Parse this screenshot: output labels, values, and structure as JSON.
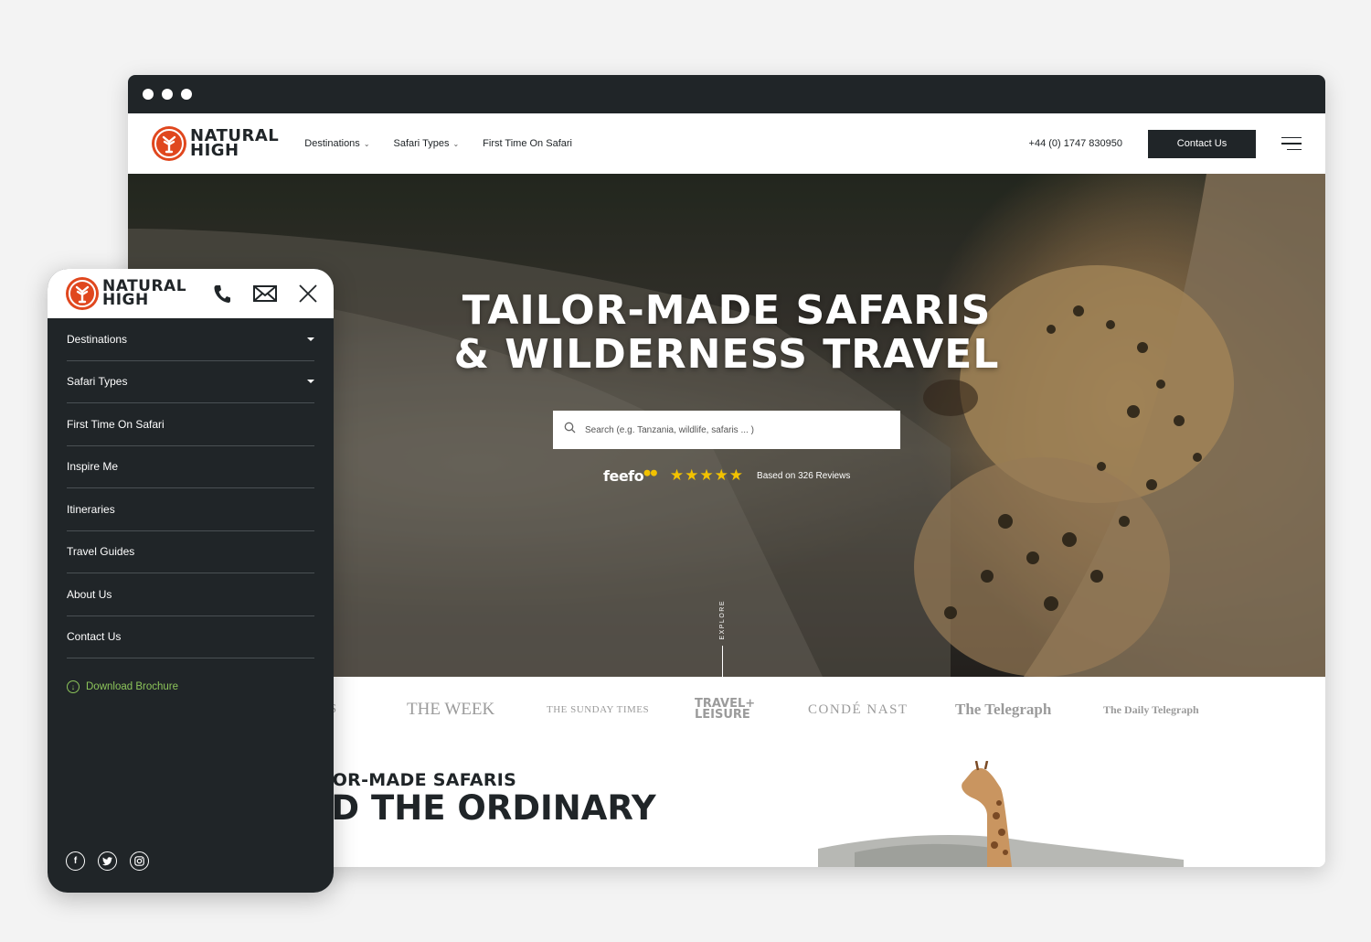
{
  "brand": {
    "name_line1": "NATURAL",
    "name_line2": "HIGH",
    "accent": "#e0471e",
    "dark": "#202528",
    "green": "#8cc45a"
  },
  "desktop": {
    "nav": [
      {
        "label": "Destinations",
        "has_dropdown": true
      },
      {
        "label": "Safari Types",
        "has_dropdown": true
      },
      {
        "label": "First Time On Safari",
        "has_dropdown": false
      }
    ],
    "phone": "+44 (0) 1747 830950",
    "contact_button": "Contact Us",
    "hero": {
      "title_line1": "TAILOR-MADE SAFARIS",
      "title_line2": "& WILDERNESS TRAVEL",
      "search_placeholder": "Search (e.g. Tanzania, wildlife, safaris ... )",
      "feefo_logo": "feefo",
      "rating_stars": 5,
      "stars_display": "★★★★★",
      "reviews_text": "Based on 326 Reviews",
      "explore_label": "EXPLORE"
    },
    "press": [
      "IES",
      "THE WEEK",
      "THE SUNDAY TIMES",
      "TRAVEL+ LEISURE",
      "CONDÉ NAST",
      "The Telegraph",
      "The Daily Telegraph"
    ],
    "intro": {
      "subtitle": "LOR-MADE SAFARIS",
      "title": "OND THE ORDINARY"
    }
  },
  "mobile": {
    "menu": [
      {
        "label": "Destinations",
        "has_dropdown": true
      },
      {
        "label": "Safari Types",
        "has_dropdown": true
      },
      {
        "label": "First Time On Safari",
        "has_dropdown": false
      },
      {
        "label": "Inspire Me",
        "has_dropdown": false
      },
      {
        "label": "Itineraries",
        "has_dropdown": false
      },
      {
        "label": "Travel Guides",
        "has_dropdown": false
      },
      {
        "label": "About Us",
        "has_dropdown": false
      },
      {
        "label": "Contact Us",
        "has_dropdown": false
      }
    ],
    "download_brochure": "Download Brochure",
    "icons": [
      "phone-icon",
      "mail-icon",
      "close-icon"
    ],
    "socials": [
      "facebook-icon",
      "twitter-icon",
      "instagram-icon"
    ]
  }
}
